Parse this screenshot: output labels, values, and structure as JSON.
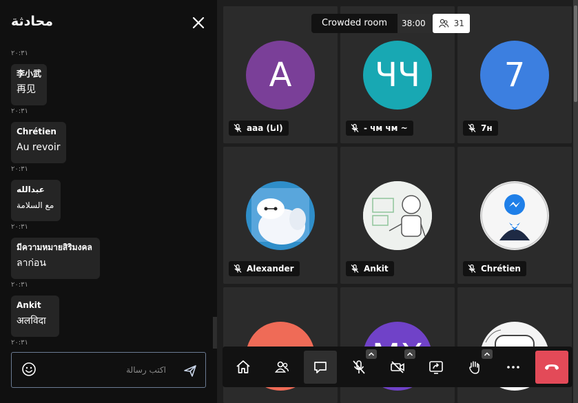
{
  "chat": {
    "title": "محادثة",
    "input_placeholder": "اكتب رسالة",
    "messages": [
      {
        "time_before": "٢٠:٣١",
        "name": "李小武",
        "text": "再见"
      },
      {
        "time_before": "٢٠:٣١",
        "name": "Chrétien",
        "text": "Au revoir"
      },
      {
        "time_before": "٢٠:٣١",
        "name": "عبدالله",
        "text": "مع السلامة"
      },
      {
        "time_before": "٢٠:٣١",
        "name": "มีความหมายสิริมงคล",
        "text": "ลาก่อน"
      },
      {
        "time_before": "٢٠:٣١",
        "name": "Ankit",
        "text": "अलविदा"
      }
    ],
    "last_time": "٢٠:٣١",
    "top_time": "٢٠:٣١"
  },
  "room": {
    "name": "Crowded room",
    "timer": "38:00",
    "participant_count": "31"
  },
  "tiles": [
    {
      "initials": "A",
      "color": "#7a3f98",
      "name": "aaa (انا)"
    },
    {
      "initials": "ЧЧ",
      "color": "#18a8b3",
      "name": "- чм чм ~"
    },
    {
      "initials": "7",
      "color": "#3c7fe0",
      "name": "7н"
    },
    {
      "initials": "",
      "color": "#2f8ec9",
      "name": "Alexander",
      "image": "baymax"
    },
    {
      "initials": "",
      "color": "#eeeeee",
      "name": "Ankit",
      "image": "robot"
    },
    {
      "initials": "",
      "color": "#f1f1f1",
      "name": "Chrétien",
      "image": "messenger"
    },
    {
      "initials": "",
      "color": "#ef6b57",
      "name": ""
    },
    {
      "initials": "MX",
      "color": "#7042c8",
      "name": ""
    },
    {
      "initials": "",
      "color": "#f4f4f4",
      "name": "",
      "image": "hello"
    }
  ],
  "toolbar": {
    "buttons": [
      "home-icon",
      "participants-icon",
      "chat-icon",
      "mic-muted-icon",
      "camera-off-icon",
      "share-screen-icon",
      "raise-hand-icon",
      "more-icon",
      "hangup-icon"
    ]
  }
}
